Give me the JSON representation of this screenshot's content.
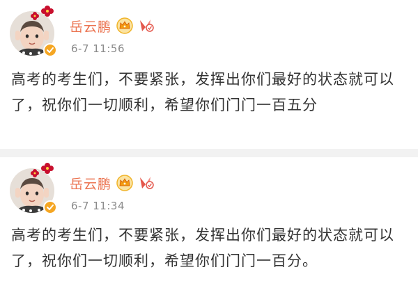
{
  "posts": [
    {
      "username": "岳云鹏",
      "timestamp": "6-7 11:56",
      "text": "高考的考生们，不要紧张，发挥出你们最好的状态就可以了，祝你们一切顺利，希望你们门门一百五分"
    },
    {
      "username": "岳云鹏",
      "timestamp": "6-7 11:34",
      "text": "高考的考生们，不要紧张，发挥出你们最好的状态就可以了，祝你们一切顺利，希望你们门门一百分。"
    }
  ],
  "colors": {
    "username": "#eb7350",
    "timestamp": "#8a8a8a",
    "body_text": "#333333",
    "separator": "#f2f2f2",
    "verified_badge": "#f5a623"
  },
  "icons": {
    "verified": "verified-badge-icon",
    "vip": "crown-vip-icon",
    "medal": "fan-medal-icon",
    "avatar_decoration": "flower-icon"
  }
}
